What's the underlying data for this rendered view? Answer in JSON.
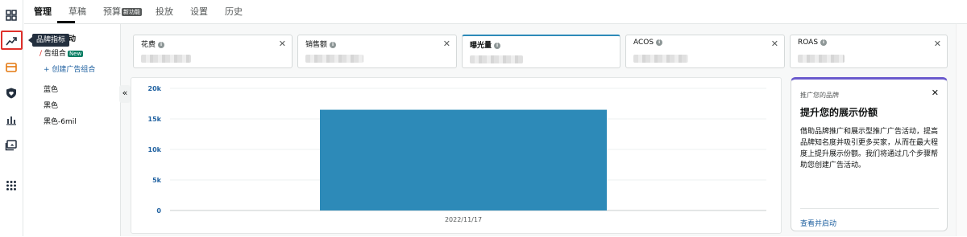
{
  "rail": {
    "icons": [
      "dashboard-grid-icon",
      "trend-line-icon",
      "card-icon",
      "shield-heart-icon",
      "bar-chart-icon",
      "media-icon",
      "apps-grid-icon"
    ],
    "tooltip": "品牌指标",
    "highlight_color": "#e0302b"
  },
  "tabs": [
    {
      "label": "管理",
      "active": true
    },
    {
      "label": "草稿",
      "active": false
    },
    {
      "label": "预算",
      "active": false,
      "chip": "新功能"
    },
    {
      "label": "投放",
      "active": false
    },
    {
      "label": "设置",
      "active": false
    },
    {
      "label": "历史",
      "active": false
    }
  ],
  "subnav": {
    "campaigns": "活动",
    "portfolio": "告组合",
    "new_badge": "New",
    "create_portfolio": "+ 创建广告组合",
    "items": [
      "蓝色",
      "黑色",
      "黑色-6mil"
    ]
  },
  "metrics": [
    {
      "label": "花费",
      "selected": false
    },
    {
      "label": "销售额",
      "selected": false
    },
    {
      "label": "曝光量",
      "selected": true
    },
    {
      "label": "ACOS",
      "selected": false
    },
    {
      "label": "ROAS",
      "selected": false
    }
  ],
  "chart_data": {
    "type": "bar",
    "categories": [
      "2022/11/17"
    ],
    "values": [
      16500
    ],
    "y_ticks": [
      "0",
      "5k",
      "10k",
      "15k",
      "20k"
    ],
    "ylim": [
      0,
      20000
    ],
    "bar_color": "#2d8ab8",
    "tick_color": "#2162a1",
    "grid": true
  },
  "promo": {
    "eyebrow": "推广您的品牌",
    "title": "提升您的展示份额",
    "body": "借助品牌推广和展示型推广广告活动，提高品牌知名度并吸引更多买家，从而在最大程度上提升展示份额。我们将通过几个步骤帮助您创建广告活动。",
    "link": "查看并启动",
    "accent": "#6a5acd"
  }
}
